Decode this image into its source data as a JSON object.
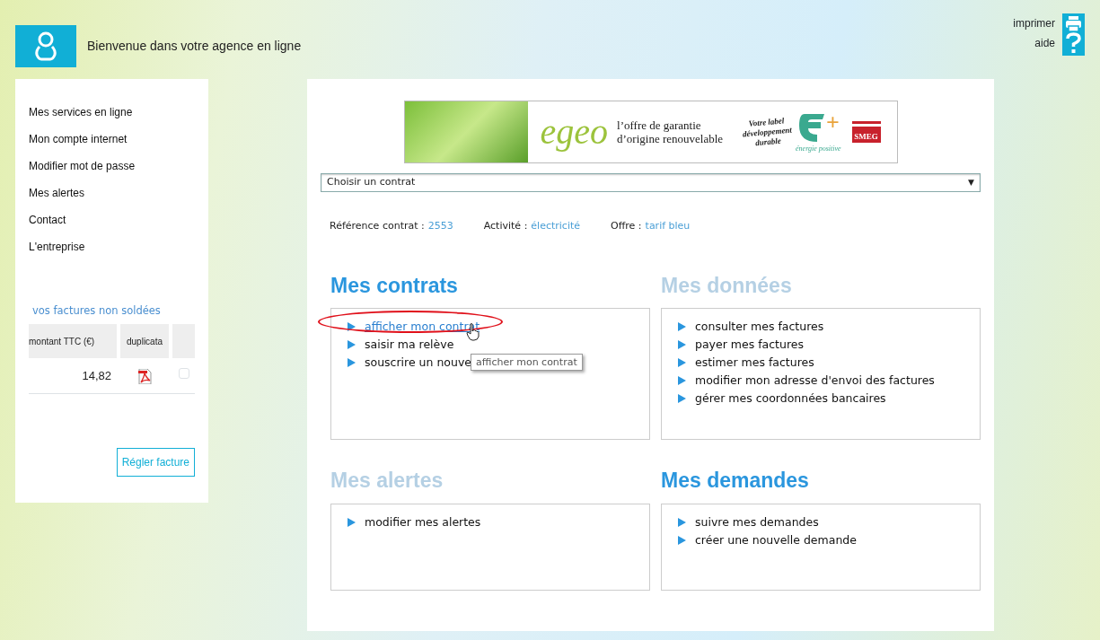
{
  "header": {
    "welcome": "Bienvenue dans votre agence en ligne",
    "actions": [
      {
        "kind": "print",
        "label": "imprimer"
      },
      {
        "kind": "help",
        "label": "aide"
      }
    ]
  },
  "sidebar": {
    "menu": [
      "Mes services en ligne",
      "Mon compte internet",
      "Modifier mot de passe",
      "Mes alertes",
      "Contact",
      "L'entreprise"
    ],
    "invoices": {
      "title": "vos factures non soldées",
      "columns": [
        "montant TTC (€)",
        "duplicata"
      ],
      "rows": [
        {
          "amount": "14,82",
          "checked": false
        }
      ],
      "button": "Régler facture"
    }
  },
  "banner": {
    "brand": "egeo",
    "tagline": [
      "l’offre de garantie",
      "d’origine renouvelable"
    ],
    "label": [
      "Votre label",
      "développement",
      "durable"
    ],
    "badge": "énergie positive",
    "badge_mark": "+",
    "logo": "SMEG"
  },
  "contract_select": {
    "value": "Choisir un contrat",
    "caret": "▼"
  },
  "contract_info": [
    {
      "label": "Référence contrat :",
      "value": "2553"
    },
    {
      "label": "Activité :",
      "value": "électricité"
    },
    {
      "label": "Offre :",
      "value": "tarif bleu"
    }
  ],
  "sections": [
    {
      "title": "Mes contrats",
      "highlighted": true,
      "items": [
        {
          "label": "afficher mon contrat",
          "hovered": true,
          "circled": true
        },
        {
          "label": "saisir ma relève",
          "hovered": false,
          "circled": false
        },
        {
          "label": "souscrire un nouve",
          "hovered": false,
          "circled": false
        }
      ]
    },
    {
      "title": "Mes données",
      "highlighted": false,
      "items": [
        {
          "label": "consulter mes factures",
          "hovered": false,
          "circled": false
        },
        {
          "label": "payer mes factures",
          "hovered": false,
          "circled": false
        },
        {
          "label": "estimer mes factures",
          "hovered": false,
          "circled": false
        },
        {
          "label": "modifier mon adresse d'envoi des factures",
          "hovered": false,
          "circled": false
        },
        {
          "label": "gérer mes coordonnées bancaires",
          "hovered": false,
          "circled": false
        }
      ]
    },
    {
      "title": "Mes alertes",
      "highlighted": false,
      "items": [
        {
          "label": "modifier mes alertes",
          "hovered": false,
          "circled": false
        }
      ]
    },
    {
      "title": "Mes demandes",
      "highlighted": true,
      "items": [
        {
          "label": "suivre mes demandes",
          "hovered": false,
          "circled": false
        },
        {
          "label": "créer une nouvelle demande",
          "hovered": false,
          "circled": false
        }
      ]
    }
  ],
  "tooltip": "afficher mon contrat"
}
